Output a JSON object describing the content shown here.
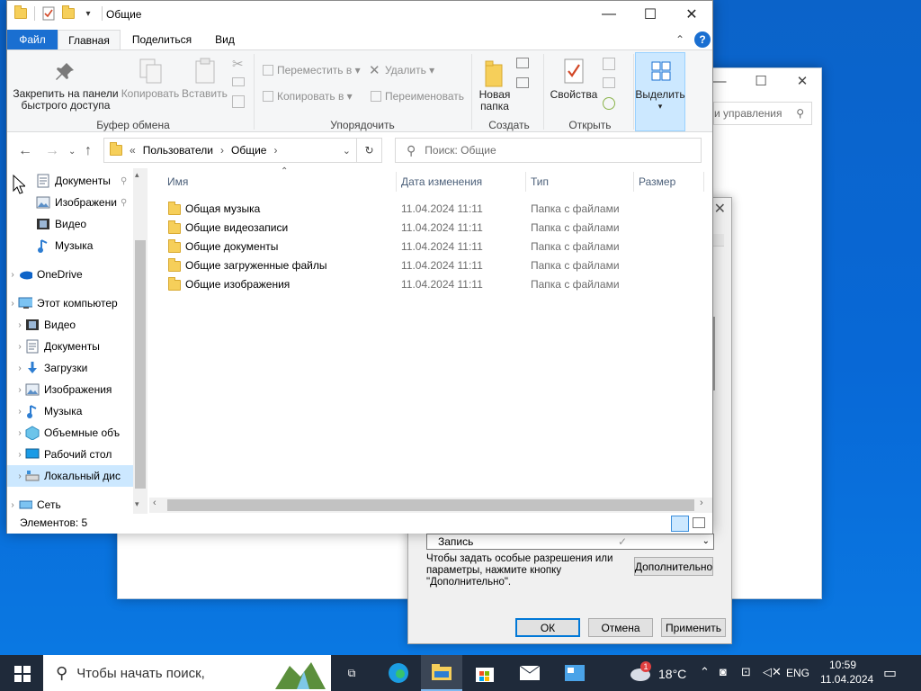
{
  "control_panel": {
    "search_placeholder": "и управления"
  },
  "dialog": {
    "permission_row": "Запись",
    "hint": "Чтобы задать особые разрешения или параметры, нажмите кнопку \"Дополнительно\".",
    "advanced_button": "Дополнительно",
    "ok_button": "ОК",
    "cancel_button": "Отмена",
    "apply_button": "Применить"
  },
  "explorer": {
    "title": "Общие",
    "tabs": {
      "file": "Файл",
      "home": "Главная",
      "share": "Поделиться",
      "view": "Вид"
    },
    "ribbon": {
      "pin": "Закрепить на панели быстрого доступа",
      "copy": "Копировать",
      "paste": "Вставить",
      "clipboard_group": "Буфер обмена",
      "move_to": "Переместить в",
      "copy_to": "Копировать в",
      "delete": "Удалить",
      "rename": "Переименовать",
      "organize_group": "Упорядочить",
      "new_folder": "Новая папка",
      "create_group": "Создать",
      "properties": "Свойства",
      "open_group": "Открыть",
      "select": "Выделить"
    },
    "address": {
      "prefix": "«",
      "path": [
        "Пользователи",
        "Общие"
      ]
    },
    "search_placeholder": "Поиск: Общие",
    "nav": {
      "quick": [
        {
          "label": "Документы",
          "icon": "documents-icon"
        },
        {
          "label": "Изображени",
          "icon": "pictures-icon"
        },
        {
          "label": "Видео",
          "icon": "video-icon"
        },
        {
          "label": "Музыка",
          "icon": "music-icon"
        }
      ],
      "onedrive": "OneDrive",
      "this_pc": "Этот компьютер",
      "pc_items": [
        {
          "label": "Видео",
          "icon": "video-icon"
        },
        {
          "label": "Документы",
          "icon": "documents-icon"
        },
        {
          "label": "Загрузки",
          "icon": "downloads-icon"
        },
        {
          "label": "Изображения",
          "icon": "pictures-icon"
        },
        {
          "label": "Музыка",
          "icon": "music-icon"
        },
        {
          "label": "Объемные объ",
          "icon": "3d-objects-icon"
        },
        {
          "label": "Рабочий стол",
          "icon": "desktop-icon"
        },
        {
          "label": "Локальный дис",
          "icon": "drive-icon"
        }
      ],
      "network": "Сеть"
    },
    "columns": {
      "name": "Имя",
      "date": "Дата изменения",
      "type": "Тип",
      "size": "Размер"
    },
    "files": [
      {
        "name": "Общая музыка",
        "date": "11.04.2024 11:11",
        "type": "Папка с файлами"
      },
      {
        "name": "Общие видеозаписи",
        "date": "11.04.2024 11:11",
        "type": "Папка с файлами"
      },
      {
        "name": "Общие документы",
        "date": "11.04.2024 11:11",
        "type": "Папка с файлами"
      },
      {
        "name": "Общие загруженные файлы",
        "date": "11.04.2024 11:11",
        "type": "Папка с файлами"
      },
      {
        "name": "Общие изображения",
        "date": "11.04.2024 11:11",
        "type": "Папка с файлами"
      }
    ],
    "status": "Элементов: 5"
  },
  "taskbar": {
    "search_placeholder": "Чтобы начать поиск,",
    "weather": "18°C",
    "mail_badge": "1",
    "language": "ENG",
    "time": "10:59",
    "date": "11.04.2024"
  },
  "colors": {
    "accent": "#1a6fd1",
    "folder": "#f6cf5a",
    "selection": "#cce8ff",
    "taskbar": "#1f2a3a"
  }
}
